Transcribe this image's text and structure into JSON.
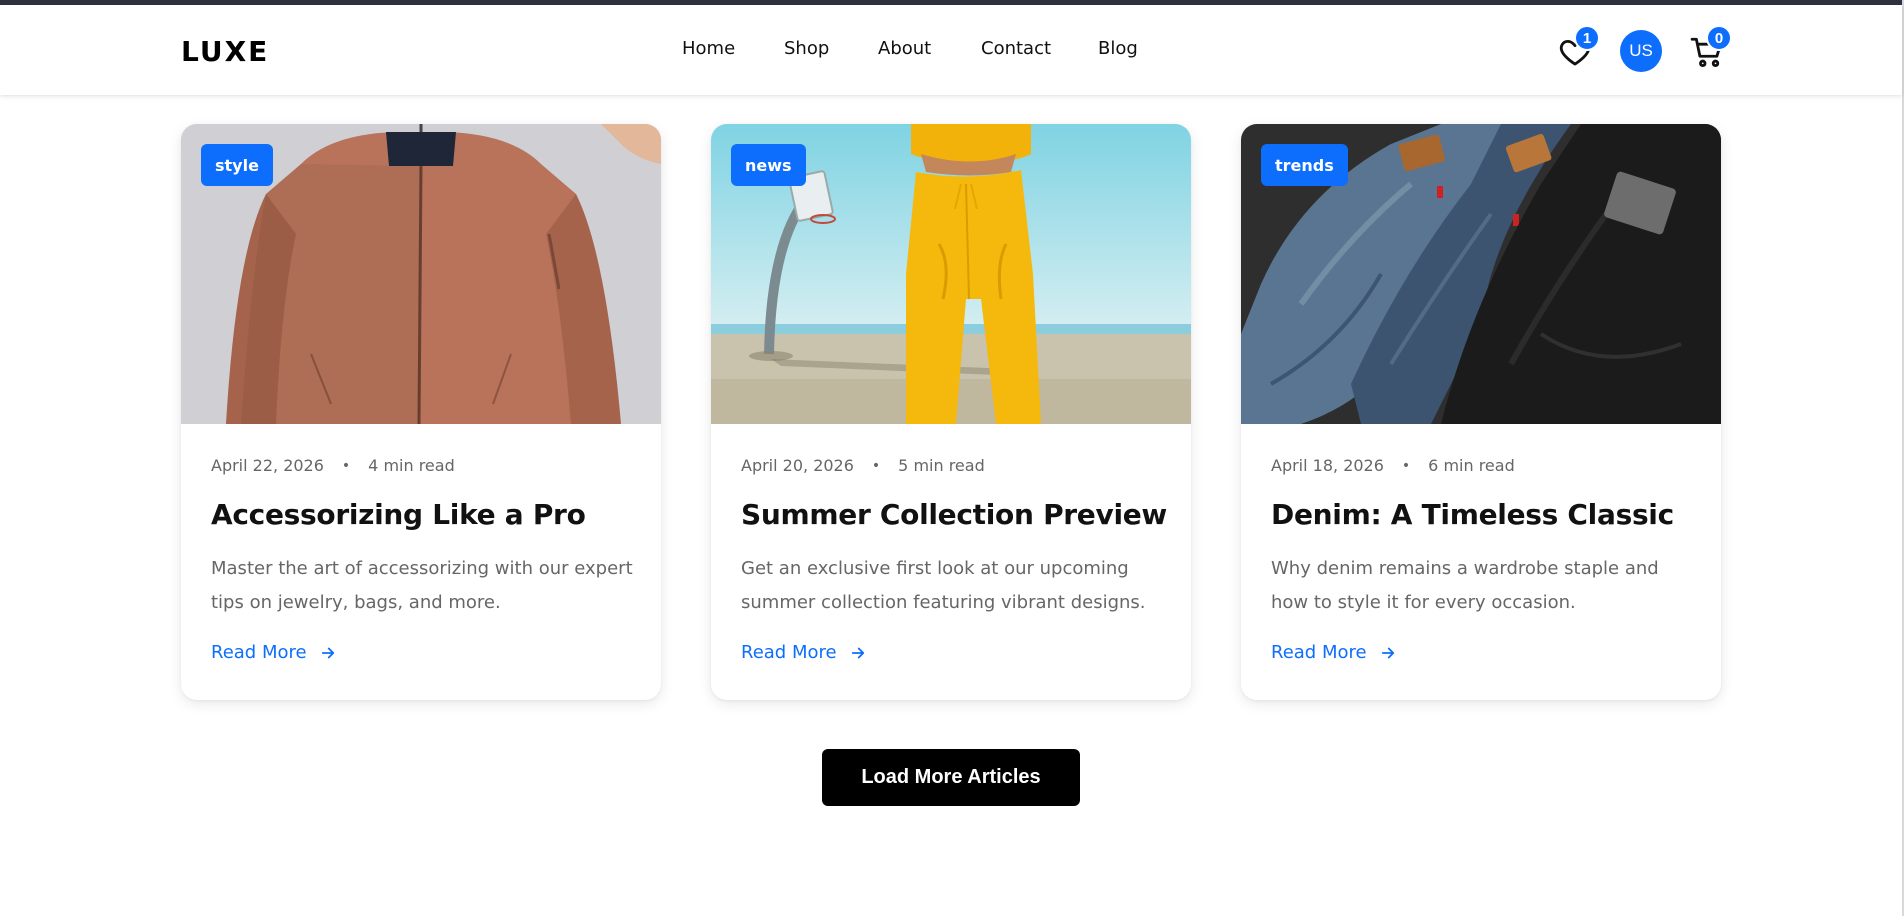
{
  "brand": {
    "logo": "LUXE"
  },
  "nav": {
    "items": [
      {
        "label": "Home"
      },
      {
        "label": "Shop"
      },
      {
        "label": "About"
      },
      {
        "label": "Contact"
      },
      {
        "label": "Blog"
      }
    ]
  },
  "header_actions": {
    "wishlist": {
      "icon": "heart-icon",
      "count": "1"
    },
    "user": {
      "initials": "US"
    },
    "cart": {
      "icon": "cart-icon",
      "count": "0"
    }
  },
  "colors": {
    "accent": "#0d6efd",
    "text": "#111111",
    "muted": "#666666",
    "button_bg": "#000000"
  },
  "articles": [
    {
      "tag": "style",
      "date": "April 22, 2026",
      "read_time": "4 min read",
      "title": "Accessorizing Like a Pro",
      "excerpt": "Master the art of accessorizing with our expert tips on jewelry, bags, and more.",
      "link_label": "Read More",
      "image": "rust-bomber-jacket-photo"
    },
    {
      "tag": "news",
      "date": "April 20, 2026",
      "read_time": "5 min read",
      "title": "Summer Collection Preview",
      "excerpt": "Get an exclusive first look at our upcoming summer collection featuring vibrant designs.",
      "link_label": "Read More",
      "image": "yellow-outfit-basketball-court-photo"
    },
    {
      "tag": "trends",
      "date": "April 18, 2026",
      "read_time": "6 min read",
      "title": "Denim: A Timeless Classic",
      "excerpt": "Why denim remains a wardrobe staple and how to style it for every occasion.",
      "link_label": "Read More",
      "image": "stacked-jeans-photo"
    }
  ],
  "actions": {
    "load_more_label": "Load More Articles"
  }
}
